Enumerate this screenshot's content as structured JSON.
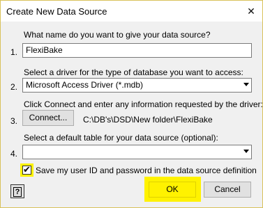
{
  "window": {
    "title": "Create New Data Source",
    "close_glyph": "✕"
  },
  "step1": {
    "number": "1.",
    "prompt": "What name do you want to give your data source?",
    "value": "FlexiBake"
  },
  "step2": {
    "number": "2.",
    "prompt": "Select a driver for the type of database you want to access:",
    "selected": "Microsoft Access Driver (*.mdb)"
  },
  "step3": {
    "number": "3.",
    "prompt": "Click Connect and enter any information requested by the driver:",
    "connect_label": "Connect...",
    "path": "C:\\DB's\\DSD\\New folder\\FlexiBake"
  },
  "step4": {
    "number": "4.",
    "prompt": "Select a default table for your data source (optional):",
    "selected": ""
  },
  "save_credentials": {
    "label": "Save my user ID and password in the data source definition",
    "checked": true,
    "check_glyph": "✔"
  },
  "footer": {
    "help_glyph": "?",
    "ok_label": "OK",
    "cancel_label": "Cancel"
  },
  "colors": {
    "highlight": "#fff200",
    "dialog_bg": "#f0f0f0"
  }
}
